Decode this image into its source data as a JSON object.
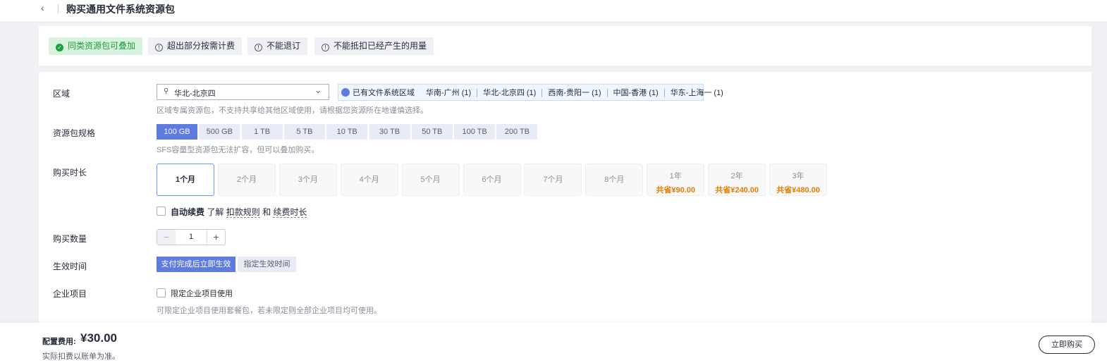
{
  "header": {
    "back_icon": "chevron-left-icon",
    "title": "购买通用文件系统资源包"
  },
  "tags": [
    {
      "label": "同类资源包可叠加",
      "icon": "check-circle-icon",
      "status": "success"
    },
    {
      "label": "超出部分按需计费",
      "icon": "info-circle-icon"
    },
    {
      "label": "不能退订",
      "icon": "info-circle-icon"
    },
    {
      "label": "不能抵扣已经产生的用量",
      "icon": "info-circle-icon"
    }
  ],
  "region": {
    "label": "区域",
    "selected": "华北-北京四",
    "hint": "区域专属资源包，不支持共享给其他区域使用，请根据您资源所在地谨慎选择。",
    "existing_label": "已有文件系统区域",
    "existing": [
      "华南-广州 (1)",
      "华北-北京四 (1)",
      "西南-贵阳一 (1)",
      "中国-香港 (1)",
      "华东-上海一 (1)"
    ]
  },
  "spec": {
    "label": "资源包规格",
    "options": [
      "100 GB",
      "500 GB",
      "1 TB",
      "5 TB",
      "10 TB",
      "30 TB",
      "50 TB",
      "100 TB",
      "200 TB"
    ],
    "selected": "100 GB",
    "hint": "SFS容量型资源包无法扩容，但可以叠加购买。"
  },
  "duration": {
    "label": "购买时长",
    "options": [
      {
        "label": "1个月"
      },
      {
        "label": "2个月"
      },
      {
        "label": "3个月"
      },
      {
        "label": "4个月"
      },
      {
        "label": "5个月"
      },
      {
        "label": "6个月"
      },
      {
        "label": "7个月"
      },
      {
        "label": "8个月"
      },
      {
        "label": "1年",
        "save": "共省¥90.00"
      },
      {
        "label": "2年",
        "save": "共省¥240.00"
      },
      {
        "label": "3年",
        "save": "共省¥480.00"
      }
    ],
    "selected": "1个月",
    "auto_renew": {
      "label": "自动续费",
      "checked": false,
      "learn": "了解",
      "link1": "扣款规则",
      "and": "和",
      "link2": "续费时长"
    }
  },
  "quantity": {
    "label": "购买数量",
    "value": "1"
  },
  "effective": {
    "label": "生效时间",
    "options": [
      "支付完成后立即生效",
      "指定生效时间"
    ],
    "selected": "支付完成后立即生效"
  },
  "enterprise": {
    "label": "企业项目",
    "checkbox": "限定企业项目使用",
    "checked": false,
    "hint": "可限定企业项目使用套餐包，若未限定则全部企业项目均可使用。"
  },
  "footer": {
    "fee_label": "配置费用:",
    "fee": "¥30.00",
    "hint": "实际扣费以账单为准。",
    "buy": "立即购买"
  },
  "colors": {
    "accent": "#5e7ce0",
    "success": "#1b9e3e",
    "save": "#e37d00"
  }
}
